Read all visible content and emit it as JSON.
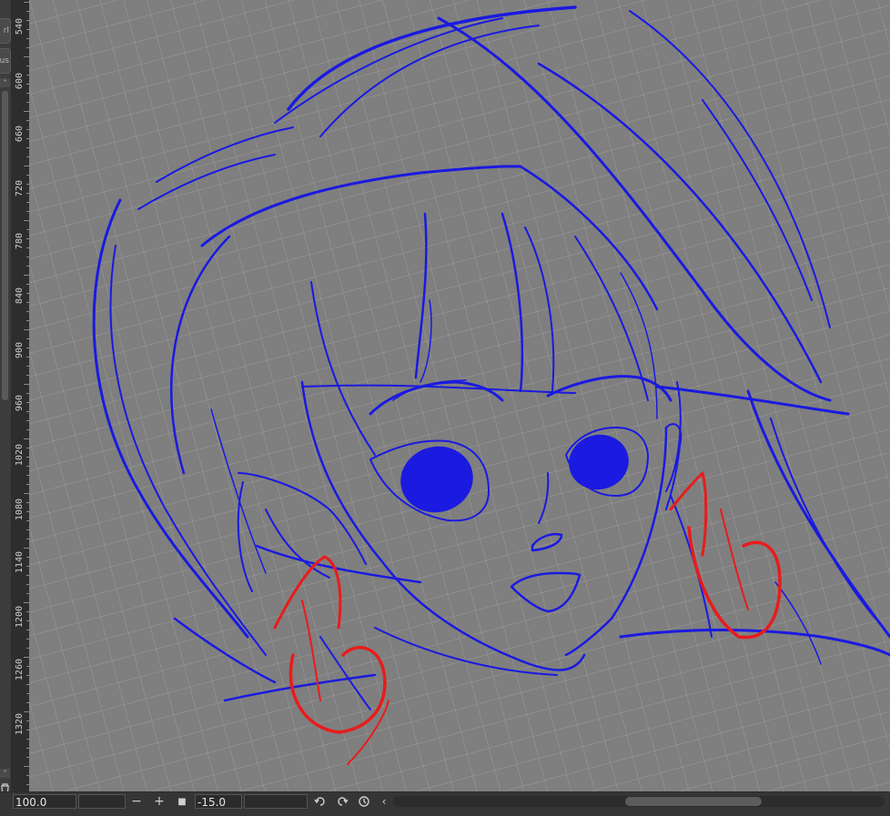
{
  "left_panel": {
    "tabs": [
      "rl",
      "us"
    ],
    "up_icon": "chevron-up-icon",
    "down_icon": "chevron-down-icon",
    "trash_icon": "trash-icon"
  },
  "ruler": {
    "labels": [
      "540",
      "600",
      "660",
      "720",
      "780",
      "840",
      "900",
      "960",
      "1020",
      "1080",
      "1140",
      "1200",
      "1260",
      "1320"
    ]
  },
  "canvas": {
    "background": "#7f7f7f",
    "grid_color": "#a9a9a9",
    "sketch_colors": {
      "primary": "#1a1ae0",
      "accent": "#e81c1c"
    }
  },
  "bottom_bar": {
    "zoom_value": "100.0",
    "rotation_value": "-15.0",
    "minus_label": "−",
    "plus_label": "+",
    "reset_label": "■",
    "undo_icon": "rotate-left-icon",
    "redo_icon": "rotate-right-icon",
    "reset_rotation_icon": "reset-rotation-icon",
    "scroll_left_icon": "chevron-left-icon"
  }
}
